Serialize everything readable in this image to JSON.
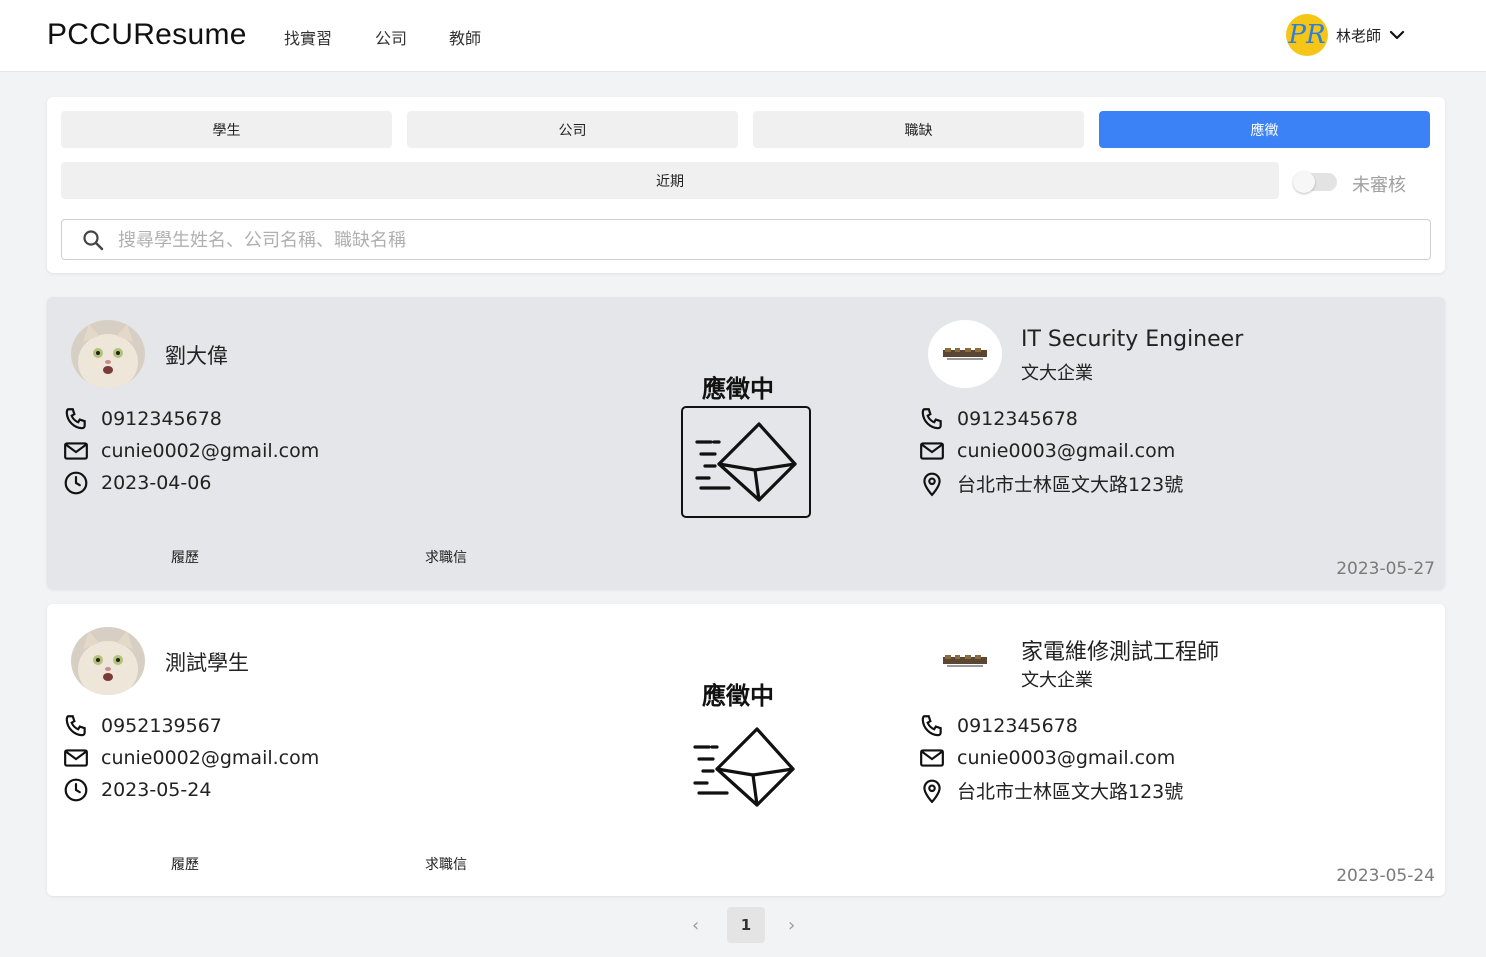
{
  "navbar": {
    "brand": "PCCUResume",
    "links": [
      "找實習",
      "公司",
      "教師"
    ],
    "user_initials": "PR",
    "user_name": "林老師"
  },
  "filters": {
    "tabs": [
      "學生",
      "公司",
      "職缺",
      "應徵"
    ],
    "active_tab": "應徵",
    "recent_label": "近期",
    "toggle_label": "未審核",
    "toggle_on": false,
    "search_placeholder": "搜尋學生姓名、公司名稱、職缺名稱"
  },
  "applications": [
    {
      "student_name": "劉大偉",
      "phone": "0912345678",
      "email": "cunie0002@gmail.com",
      "date": "2023-04-06",
      "resume_label": "履歷",
      "cover_letter_label": "求職信",
      "status": "應徵中",
      "job_title": "IT Security Engineer",
      "company": "文大企業",
      "company_phone": "0912345678",
      "company_email": "cunie0003@gmail.com",
      "company_address": "台北市士林區文大路123號",
      "applied_date": "2023-05-27",
      "highlighted": true
    },
    {
      "student_name": "測試學生",
      "phone": "0952139567",
      "email": "cunie0002@gmail.com",
      "date": "2023-05-24",
      "resume_label": "履歷",
      "cover_letter_label": "求職信",
      "status": "應徵中",
      "job_title": "家電維修測試工程師",
      "company": "文大企業",
      "company_phone": "0912345678",
      "company_email": "cunie0003@gmail.com",
      "company_address": "台北市士林區文大路123號",
      "applied_date": "2023-05-24",
      "highlighted": false
    }
  ],
  "pagination": {
    "prev": "‹",
    "current": "1",
    "next": "›"
  },
  "colors": {
    "accent": "#3b82f6",
    "avatar_bg": "#f5c518",
    "highlight_card": "#e5e6e9"
  }
}
